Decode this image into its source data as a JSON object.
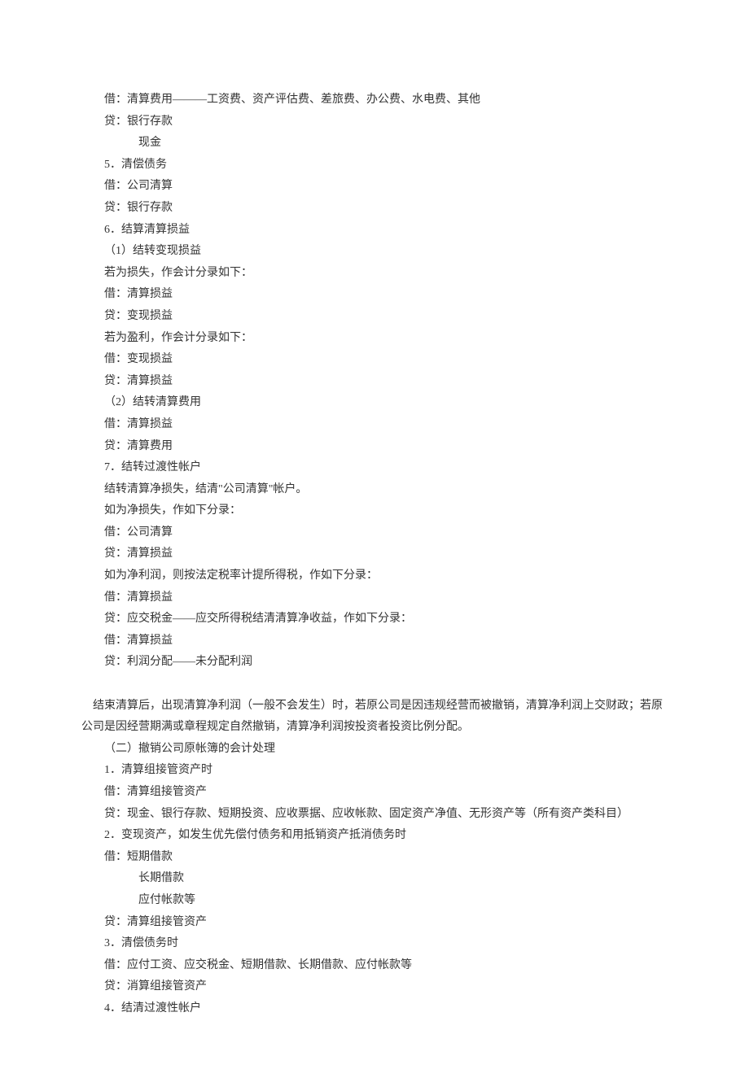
{
  "lines": [
    {
      "indent": 1,
      "text": "借：清算费用———工资费、资产评估费、差旅费、办公费、水电费、其他"
    },
    {
      "indent": 1,
      "text": "贷：银行存款"
    },
    {
      "indent": 3,
      "text": "现金"
    },
    {
      "indent": 1,
      "text": "5．清偿债务"
    },
    {
      "indent": 1,
      "text": "借：公司清算"
    },
    {
      "indent": 1,
      "text": "贷：银行存款"
    },
    {
      "indent": 1,
      "text": "6．结算清算损益"
    },
    {
      "indent": 1,
      "text": "（1）结转变现损益"
    },
    {
      "indent": 1,
      "text": "若为损失，作会计分录如下："
    },
    {
      "indent": 1,
      "text": "借：清算损益"
    },
    {
      "indent": 1,
      "text": "贷：变现损益"
    },
    {
      "indent": 1,
      "text": "若为盈利，作会计分录如下："
    },
    {
      "indent": 1,
      "text": "借：变现损益"
    },
    {
      "indent": 1,
      "text": "贷：清算损益"
    },
    {
      "indent": 1,
      "text": "（2）结转清算费用"
    },
    {
      "indent": 1,
      "text": "借：清算损益"
    },
    {
      "indent": 1,
      "text": "贷：清算费用"
    },
    {
      "indent": 1,
      "text": "7．结转过渡性帐户"
    },
    {
      "indent": 1,
      "text": "结转清算净损失，结清\"公司清算\"帐户。"
    },
    {
      "indent": 1,
      "text": "如为净损失，作如下分录："
    },
    {
      "indent": 1,
      "text": "借：公司清算"
    },
    {
      "indent": 1,
      "text": "贷：清算损益"
    },
    {
      "indent": 1,
      "text": "如为净利润，则按法定税率计提所得税，作如下分录："
    },
    {
      "indent": 1,
      "text": "借：清算损益"
    },
    {
      "indent": 1,
      "text": "贷：应交税金——应交所得税结清清算净收益，作如下分录："
    },
    {
      "indent": 1,
      "text": "借：清算损益"
    },
    {
      "indent": 1,
      "text": "贷：利润分配——未分配利润"
    },
    {
      "blank": true
    },
    {
      "indent": 1,
      "wrap": true,
      "text": "　结束清算后，出现清算净利润（一般不会发生）时，若原公司是因违规经营而被撤销，清算净利润上交财政；若原公司是因经营期满或章程规定自然撤销，清算净利润按投资者投资比例分配。"
    },
    {
      "indent": 1,
      "text": "（二）撤销公司原帐簿的会计处理"
    },
    {
      "indent": 1,
      "text": "1．清算组接管资产时"
    },
    {
      "indent": 1,
      "text": "借：清算组接管资产"
    },
    {
      "indent": 0,
      "wrap": true,
      "text": "　　贷：现金、银行存款、短期投资、应收票据、应收帐款、固定资产净值、无形资产等（所有资产类科目）"
    },
    {
      "indent": 1,
      "text": "2．变现资产，如发生优先偿付债务和用抵销资产抵消债务时"
    },
    {
      "indent": 1,
      "text": "借：短期借款"
    },
    {
      "indent": 3,
      "text": "长期借款"
    },
    {
      "indent": 3,
      "text": "应付帐款等"
    },
    {
      "indent": 1,
      "text": "贷：清算组接管资产"
    },
    {
      "indent": 1,
      "text": "3．清偿债务时"
    },
    {
      "indent": 1,
      "text": "借：应付工资、应交税金、短期借款、长期借款、应付帐款等"
    },
    {
      "indent": 1,
      "text": "贷：消算组接管资产"
    },
    {
      "indent": 1,
      "text": "4．结清过渡性帐户"
    }
  ]
}
